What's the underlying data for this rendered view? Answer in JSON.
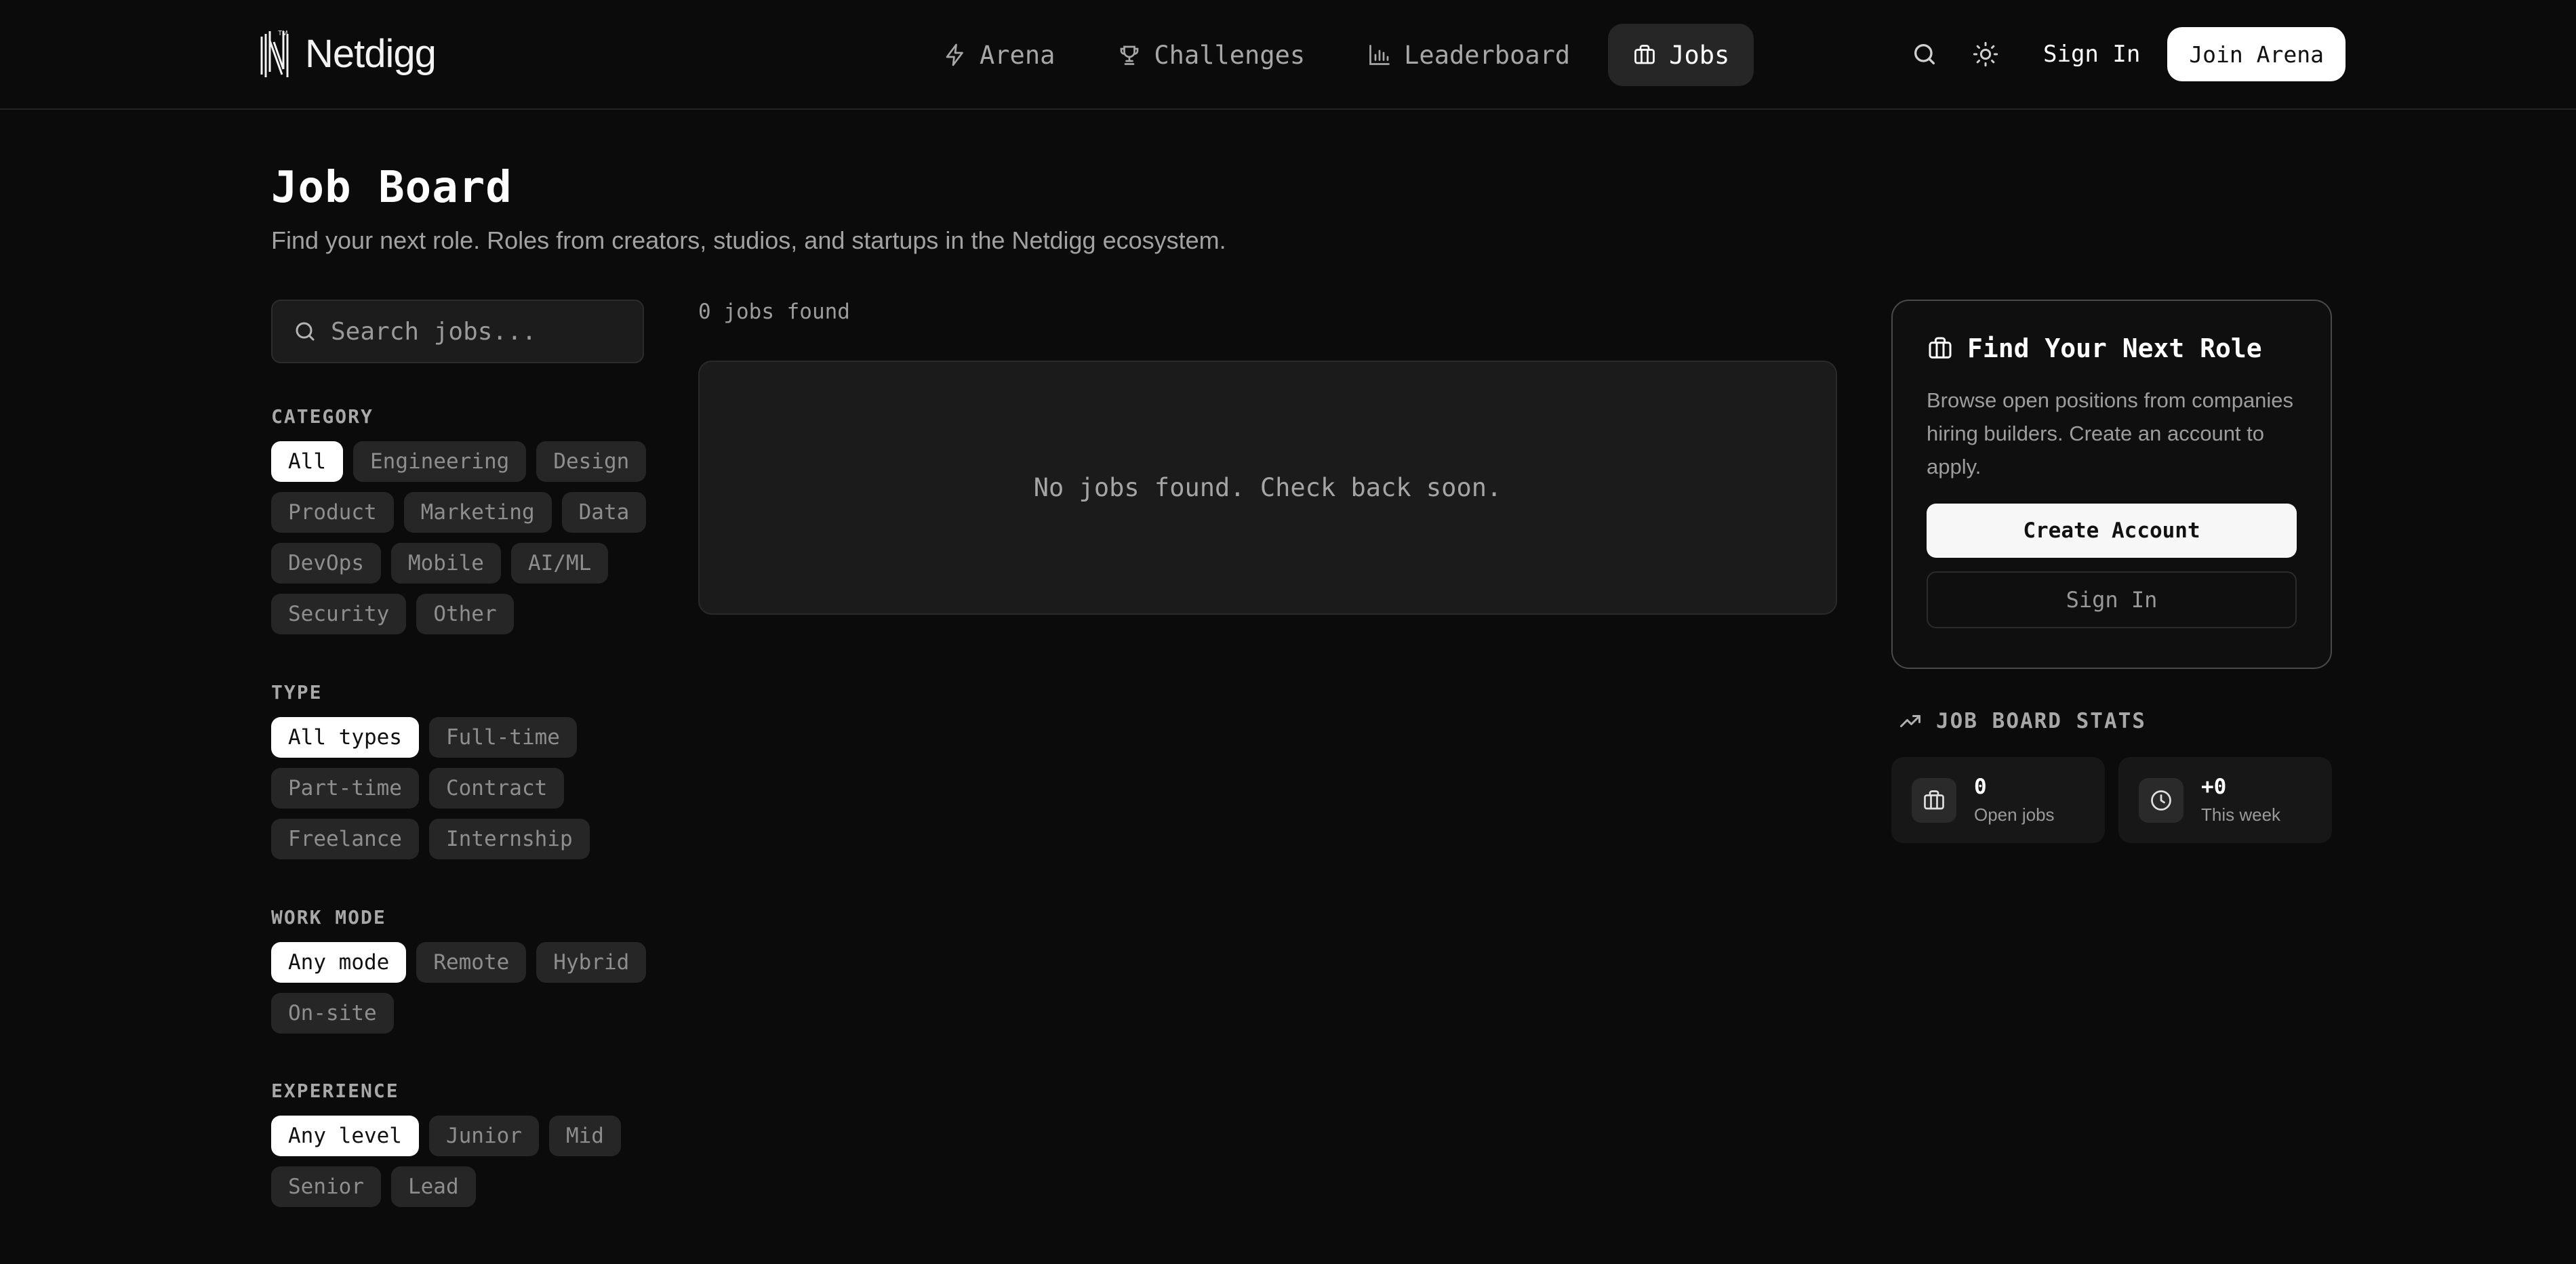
{
  "header": {
    "logo_text": "Netdigg",
    "nav": [
      {
        "label": "Arena",
        "icon": "lightning-icon",
        "active": false
      },
      {
        "label": "Challenges",
        "icon": "trophy-icon",
        "active": false
      },
      {
        "label": "Leaderboard",
        "icon": "bar-chart-icon",
        "active": false
      },
      {
        "label": "Jobs",
        "icon": "briefcase-icon",
        "active": true
      }
    ],
    "sign_in": "Sign In",
    "join": "Join Arena"
  },
  "page": {
    "title": "Job Board",
    "subtitle": "Find your next role. Roles from creators, studios, and startups in the Netdigg ecosystem."
  },
  "search": {
    "placeholder": "Search jobs..."
  },
  "filters": {
    "category": {
      "label": "CATEGORY",
      "options": [
        "All",
        "Engineering",
        "Design",
        "Product",
        "Marketing",
        "Data",
        "DevOps",
        "Mobile",
        "AI/ML",
        "Security",
        "Other"
      ],
      "selected": "All"
    },
    "type": {
      "label": "TYPE",
      "options": [
        "All types",
        "Full-time",
        "Part-time",
        "Contract",
        "Freelance",
        "Internship"
      ],
      "selected": "All types"
    },
    "work_mode": {
      "label": "WORK MODE",
      "options": [
        "Any mode",
        "Remote",
        "Hybrid",
        "On-site"
      ],
      "selected": "Any mode"
    },
    "experience": {
      "label": "EXPERIENCE",
      "options": [
        "Any level",
        "Junior",
        "Mid",
        "Senior",
        "Lead"
      ],
      "selected": "Any level"
    }
  },
  "results": {
    "count_text": "0 jobs found",
    "empty_text": "No jobs found. Check back soon."
  },
  "role_card": {
    "title": "Find Your Next Role",
    "text": "Browse open positions from companies hiring builders. Create an account to apply.",
    "create_account": "Create Account",
    "sign_in": "Sign In"
  },
  "stats": {
    "title": "JOB BOARD STATS",
    "open_jobs": {
      "value": "0",
      "label": "Open jobs"
    },
    "this_week": {
      "value": "+0",
      "label": "This week"
    }
  },
  "colors": {
    "background": "#0b0b0b",
    "active_chip": "#ffffff",
    "chip": "#262626",
    "card_border": "#4a4a4a"
  }
}
